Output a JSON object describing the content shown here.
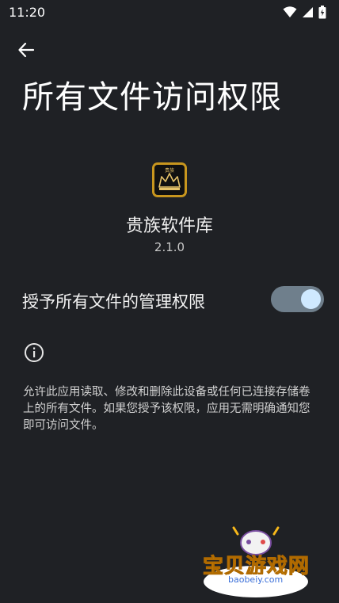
{
  "status_bar": {
    "time": "11:20",
    "icons": [
      "wifi-icon",
      "signal-icon",
      "battery-icon"
    ]
  },
  "header": {
    "back_icon": "arrow-left-icon",
    "title": "所有文件访问权限"
  },
  "app": {
    "icon_text": "贵族",
    "name": "贵族软件库",
    "version": "2.1.0"
  },
  "permission": {
    "label": "授予所有文件的管理权限",
    "enabled": true
  },
  "info": {
    "icon": "info-icon",
    "description": "允许此应用读取、修改和删除此设备或任何已连接存储卷上的所有文件。如果您授予该权限，应用无需明确通知您即可访问文件。"
  },
  "watermark": {
    "text": "宝贝游戏网",
    "url": "baobeiy.com"
  },
  "colors": {
    "background": "#1f2125",
    "toggle_track": "#6f7f8c",
    "toggle_thumb": "#cfe9ff"
  }
}
